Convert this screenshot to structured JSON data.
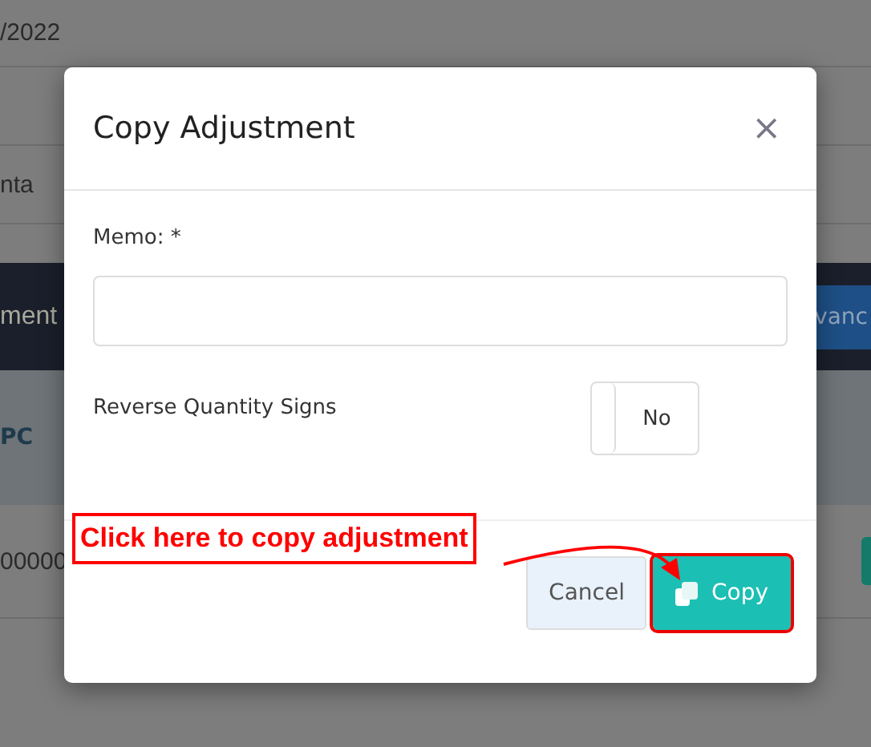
{
  "background": {
    "date_fragment": "/2022",
    "field_fragment": "nta",
    "bar_title_fragment": "ment",
    "bar_button_fragment": "vanc",
    "column_fragment": "PC",
    "cell_fragment": "00000"
  },
  "dialog": {
    "title": "Copy Adjustment",
    "close": "×",
    "memo": {
      "label": "Memo: *"
    },
    "reverse_quantity_signs": {
      "label": "Reverse Quantity Signs",
      "on": false,
      "text": "No"
    },
    "buttons": [
      {
        "label": "Cancel",
        "kind": "secondary",
        "highlighted": false
      },
      {
        "label": "Copy",
        "kind": "primary",
        "highlighted": true
      }
    ]
  },
  "annotation": {
    "text": "Click here to copy adjustment"
  }
}
